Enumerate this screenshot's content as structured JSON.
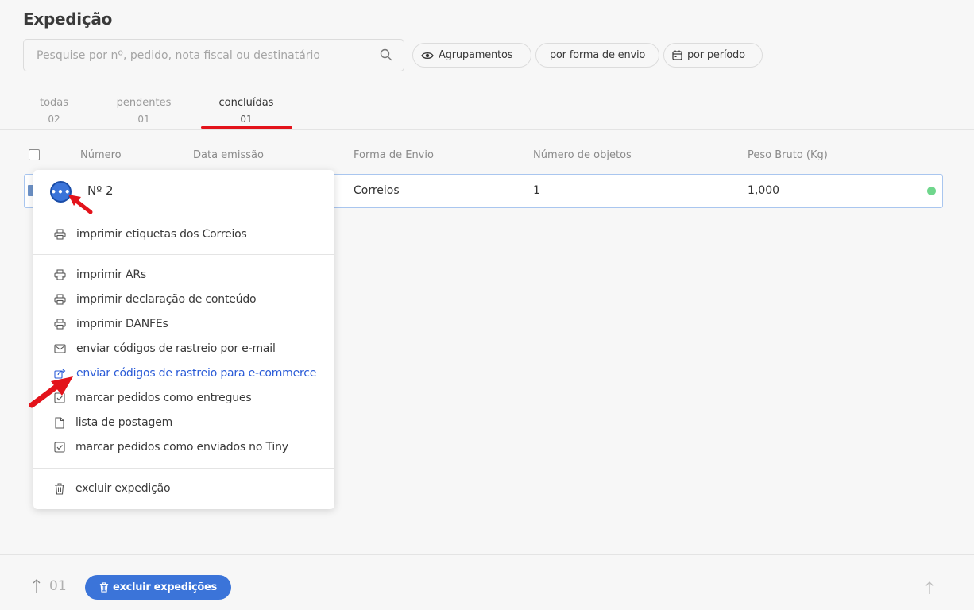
{
  "page": {
    "title": "Expedição"
  },
  "search": {
    "placeholder": "Pesquise por nº, pedido, nota fiscal ou destinatário",
    "value": ""
  },
  "filters": {
    "grouping": "Agrupamentos",
    "shipping": "por forma de envio",
    "period": "por período"
  },
  "tabs": [
    {
      "label": "todas",
      "count": "02"
    },
    {
      "label": "pendentes",
      "count": "01"
    },
    {
      "label": "concluídas",
      "count": "01"
    }
  ],
  "table": {
    "headers": [
      "Número",
      "Data emissão",
      "Forma de Envio",
      "Número de objetos",
      "Peso Bruto (Kg)"
    ],
    "row": {
      "forma_envio": "Correios",
      "objetos": "1",
      "peso": "1,000"
    }
  },
  "menu": {
    "title": "Nº 2",
    "items": [
      {
        "label": "imprimir etiquetas dos Correios",
        "icon": "printer-icon"
      },
      {
        "label": "imprimir ARs",
        "icon": "printer-icon"
      },
      {
        "label": "imprimir declaração de conteúdo",
        "icon": "printer-icon"
      },
      {
        "label": "imprimir DANFEs",
        "icon": "printer-icon"
      },
      {
        "label": "enviar códigos de rastreio por e-mail",
        "icon": "mail-icon"
      },
      {
        "label": "enviar códigos de rastreio para e-commerce",
        "icon": "share-icon"
      },
      {
        "label": "marcar pedidos como entregues",
        "icon": "checkbox-icon"
      },
      {
        "label": "lista de postagem",
        "icon": "file-icon"
      },
      {
        "label": "marcar pedidos como enviados no Tiny",
        "icon": "checkbox-icon"
      },
      {
        "label": "excluir expedição",
        "icon": "trash-icon"
      }
    ]
  },
  "footer": {
    "selected_count": "01",
    "delete_label": "excluir expedições"
  },
  "colors": {
    "accent": "#3b74d9",
    "tab_underline": "#e3131b",
    "status_ok": "#6fd68c",
    "highlight_text": "#2a5bd7"
  }
}
